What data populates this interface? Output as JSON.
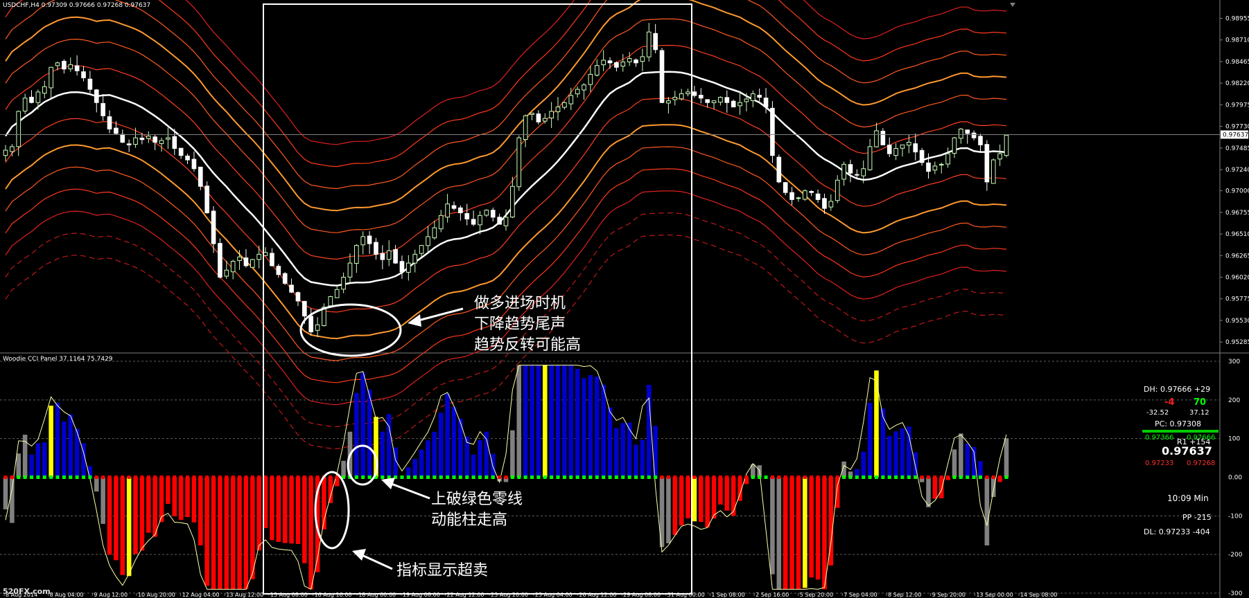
{
  "price_header": "USDCHF,H4  0.97309 0.97666 0.97268 0.97637",
  "cci_header": "Woodie CCI Panel 37.1164 75.7429",
  "watermark": "520FX.com",
  "annotations": {
    "long_entry": [
      "做多进场时机",
      "下降趋势尾声",
      "趋势反转可能高"
    ],
    "zero_break": [
      "上破绿色零线",
      "动能柱走高"
    ],
    "oversold": [
      "指标显示超卖"
    ]
  },
  "panel": {
    "dh": "DH: 0.97666 +29",
    "cci_neg": "-4",
    "cci_pos": "70",
    "cci_neg_val": "-32.52",
    "cci_pos_val": "37.12",
    "pc": "PC: 0.97308",
    "r1": "R1 +154",
    "bid_left": "0.97366",
    "bid_right": "0.97666",
    "price": "0.97637",
    "ask_left": "0.97233",
    "ask_right": "0.97268",
    "timer": "10:09 Min",
    "pp": "PP -215",
    "dl": "DL: 0.97233 -404"
  },
  "colors": {
    "background": "#000000",
    "bull_candle": "#ccffbb",
    "bear_candle": "#ffffff",
    "positive_hist": "#0000cc",
    "negative_hist": "#ff0000",
    "neutral_hist": "#808080",
    "trigger_hist": "#ffff00",
    "zero_line_green": "#00ff00",
    "zero_line_red": "#ff0000",
    "cci_line": "#ffffaa"
  },
  "chart_data": [
    {
      "type": "candlestick",
      "title": "USDCHF,H4",
      "ylim": [
        0.952,
        0.991
      ],
      "y_ticks": [
        "0.98955",
        "0.98710",
        "0.98465",
        "0.98220",
        "0.97975",
        "0.97730",
        "0.97485",
        "0.97240",
        "0.97000",
        "0.96755",
        "0.96510",
        "0.96265",
        "0.96020",
        "0.95775",
        "0.95530",
        "0.95285"
      ],
      "current_price": "0.97637",
      "x_ticks": [
        "8 Aug 2014",
        "8 Aug 04:00",
        "9 Aug 12:00",
        "10 Aug 20:00",
        "12 Aug 04:00",
        "13 Aug 12:00",
        "15 Aug 08:00",
        "16 Aug 16:00",
        "18 Aug 00:00",
        "19 Aug 08:00",
        "22 Aug 12:00",
        "23 Aug 20:00",
        "25 Aug 04:00",
        "26 Aug 12:00",
        "29 Aug 08:00",
        "31 Aug 00:00",
        "1 Sep 08:00",
        "2 Sep 16:00",
        "5 Sep 20:00",
        "7 Sep 04:00",
        "8 Sep 12:00",
        "9 Sep 20:00",
        "13 Sep 00:00",
        "14 Sep 08:00"
      ],
      "close": [
        0.9746,
        0.975,
        0.979,
        0.9805,
        0.98,
        0.9812,
        0.9818,
        0.984,
        0.9845,
        0.9838,
        0.9843,
        0.9836,
        0.9828,
        0.9815,
        0.98,
        0.9785,
        0.977,
        0.9765,
        0.9755,
        0.9752,
        0.976,
        0.9758,
        0.9762,
        0.9755,
        0.9757,
        0.976,
        0.9748,
        0.974,
        0.9735,
        0.9725,
        0.9705,
        0.9675,
        0.964,
        0.9602,
        0.961,
        0.962,
        0.9625,
        0.9615,
        0.9622,
        0.9628,
        0.963,
        0.9615,
        0.9605,
        0.9595,
        0.9585,
        0.9575,
        0.9558,
        0.954,
        0.9548,
        0.9568,
        0.958,
        0.9588,
        0.9602,
        0.9618,
        0.9638,
        0.9648,
        0.964,
        0.9628,
        0.9622,
        0.9632,
        0.9618,
        0.9608,
        0.9618,
        0.9628,
        0.9638,
        0.9648,
        0.9658,
        0.9672,
        0.9685,
        0.968,
        0.9675,
        0.9668,
        0.9662,
        0.9672,
        0.9678,
        0.967,
        0.9662,
        0.967,
        0.9705,
        0.976,
        0.9785,
        0.9788,
        0.9778,
        0.9782,
        0.979,
        0.9795,
        0.98,
        0.9808,
        0.9815,
        0.982,
        0.9832,
        0.9842,
        0.9848,
        0.9845,
        0.984,
        0.9846,
        0.985,
        0.9845,
        0.9852,
        0.988,
        0.986,
        0.98,
        0.9802,
        0.9806,
        0.981,
        0.9812,
        0.9808,
        0.9805,
        0.98,
        0.9802,
        0.9806,
        0.98,
        0.9795,
        0.98,
        0.9804,
        0.981,
        0.9806,
        0.9795,
        0.974,
        0.971,
        0.9698,
        0.969,
        0.9692,
        0.97,
        0.9698,
        0.969,
        0.968,
        0.9688,
        0.9712,
        0.973,
        0.972,
        0.9718,
        0.9725,
        0.975,
        0.9768,
        0.9752,
        0.9742,
        0.9748,
        0.9752,
        0.9755,
        0.9744,
        0.9732,
        0.9722,
        0.9728,
        0.973,
        0.9742,
        0.976,
        0.977,
        0.9765,
        0.976,
        0.9752,
        0.971,
        0.9735,
        0.9742,
        0.9763
      ]
    },
    {
      "type": "bar",
      "title": "Woodie CCI Panel",
      "ylim": [
        -300,
        300
      ],
      "y_ticks": [
        "300",
        "200",
        "100",
        "0.00",
        "-100",
        "-200",
        "-300"
      ],
      "current_values": [
        37.1164,
        75.7429
      ]
    }
  ]
}
